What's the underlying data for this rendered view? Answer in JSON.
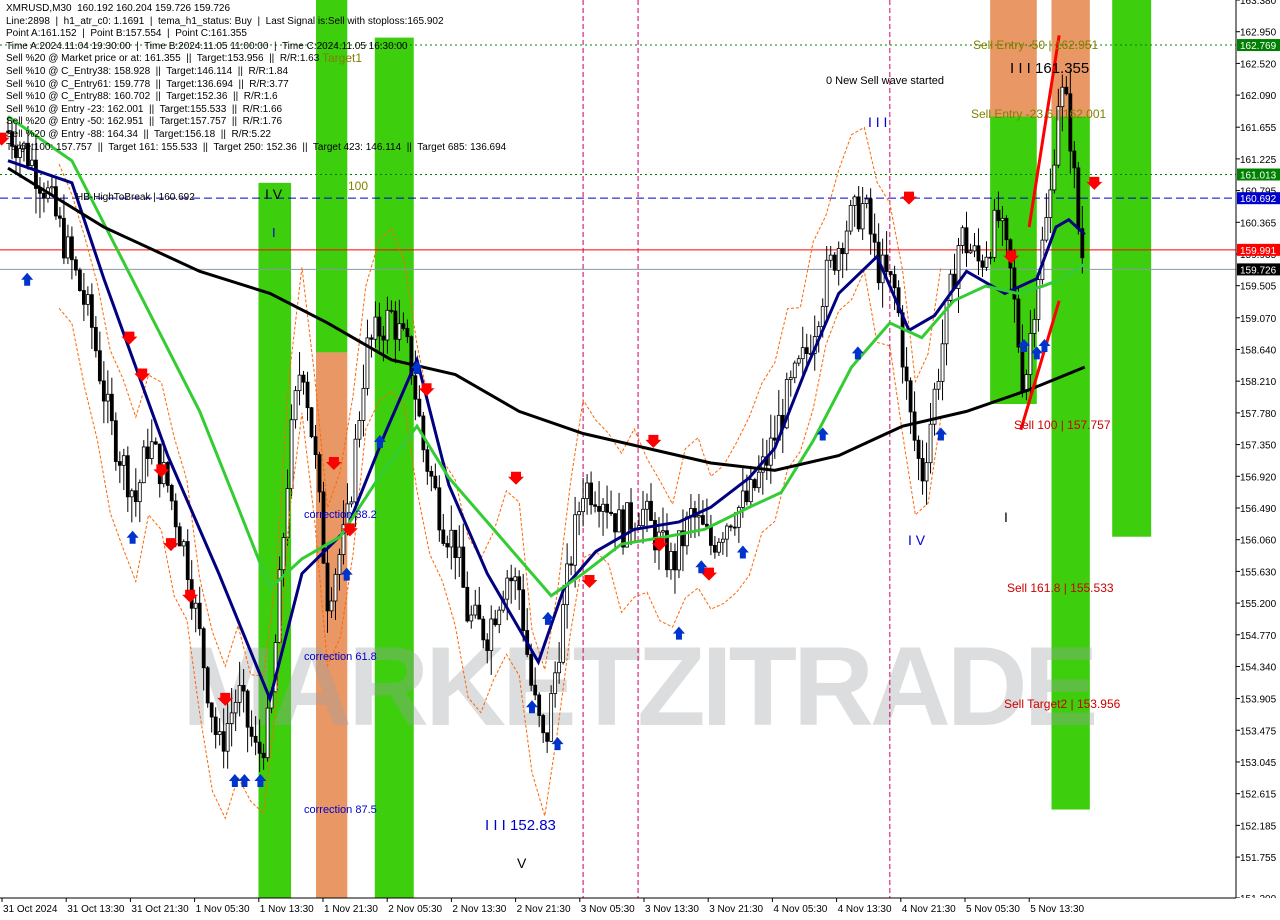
{
  "header": {
    "lines": [
      "XMRUSD,M30  160.192 160.204 159.726 159.726",
      "Line:2898  |  h1_atr_c0: 1.1691  |  tema_h1_status: Buy  |  Last Signal is:Sell with stoploss:165.902",
      "Point A:161.152  |  Point B:157.554  |  Point C:161.355",
      "Time A:2024.11.04 19:30:00  |  Time B:2024.11.05 11:00:00  |  Time C:2024.11.05 16:30:00",
      "Sell %20 @ Market price or at: 161.355  ||  Target:153.956  ||  R/R:1.63",
      "Sell %10 @ C_Entry38: 158.928  ||  Target:146.114  ||  R/R:1.84",
      "Sell %10 @ C_Entry61: 159.778  ||  Target:136.694  ||  R/R:3.77",
      "Sell %10 @ C_Entry88: 160.702  ||  Target:152.36  ||  R/R:1.6",
      "Sell %10 @ Entry -23: 162.001  ||  Target:155.533  ||  R/R:1.66",
      "Sell %20 @ Entry -50: 162.951  ||  Target:157.757  ||  R/R:1.76",
      "Sell %20 @ Entry -88: 164.34  ||  Target:156.18  ||  R/R:5.22",
      "Target100: 157.757  ||  Target 161: 155.533  ||  Target 250: 152.36  ||  Target 423: 146.114  ||  Target 685: 136.694"
    ]
  },
  "watermark": "MARKETZITRADE",
  "colors": {
    "up": "#ffffff",
    "down": "#000000",
    "green_zone": "#33cc00",
    "orange_zone": "#e8915c",
    "blue_ma": "#000080",
    "green_ma": "#33cc33",
    "black_ma": "#000000",
    "red_line": "#ff0000",
    "blue_dash": "#0000cc",
    "green_dot": "#008000",
    "magenta": "#cc0066"
  },
  "annotations": {
    "sell_entry_50": "Sell Entry -50 | 162.951",
    "sell_entry_23": "Sell Entry -23.6 | 162.001",
    "point_c": "I I I 161.355",
    "new_wave": "0 New Sell wave started",
    "wave_iii_top": "I I I",
    "wave_iv_left": "I V",
    "wave_i_left": "I",
    "label_100": "100",
    "target1": "Target1",
    "hb_break": "HB-HighToBreak | 160.692",
    "correction_38": "correction 38.2",
    "correction_61": "correction 61.8",
    "correction_87": "correction 87.5",
    "wave_iii_low": "I I I 152.83",
    "wave_v": "V",
    "wave_iv_right": "I V",
    "wave_i_right": "I",
    "sell_100": "Sell 100 | 157.757",
    "sell_161": "Sell 161.8 | 155.533",
    "sell_target2": "Sell Target2 | 153.956"
  },
  "price_tags": [
    {
      "value": 162.769,
      "label": "162.769",
      "bg": "#008000",
      "fg": "#ffffff"
    },
    {
      "value": 161.013,
      "label": "161.013",
      "bg": "#008000",
      "fg": "#ffffff"
    },
    {
      "value": 160.692,
      "label": "160.692",
      "bg": "#0000cc",
      "fg": "#ffffff"
    },
    {
      "value": 159.991,
      "label": "159.991",
      "bg": "#ff0000",
      "fg": "#ffffff"
    },
    {
      "value": 159.726,
      "label": "159.726",
      "bg": "#000000",
      "fg": "#ffffff"
    }
  ],
  "chart_data": {
    "type": "candlestick",
    "symbol": "XMRUSD",
    "timeframe": "M30",
    "ylim": [
      151.2,
      163.38
    ],
    "y_ticks": [
      "163.380",
      "162.950",
      "162.520",
      "162.090",
      "161.655",
      "161.225",
      "160.795",
      "160.365",
      "159.935",
      "159.505",
      "159.070",
      "158.640",
      "158.210",
      "157.780",
      "157.350",
      "156.920",
      "156.490",
      "156.060",
      "155.630",
      "155.200",
      "154.770",
      "154.340",
      "153.905",
      "153.475",
      "153.045",
      "152.615",
      "152.185",
      "151.755",
      "151.200"
    ],
    "x_labels": [
      "31 Oct 2024",
      "31 Oct 13:30",
      "31 Oct 21:30",
      "1 Nov 05:30",
      "1 Nov 13:30",
      "1 Nov 21:30",
      "2 Nov 05:30",
      "2 Nov 13:30",
      "2 Nov 21:30",
      "3 Nov 05:30",
      "3 Nov 13:30",
      "3 Nov 21:30",
      "4 Nov 05:30",
      "4 Nov 13:30",
      "4 Nov 21:30",
      "5 Nov 05:30",
      "5 Nov 13:30"
    ],
    "last_price": 159.726,
    "horizontal_levels": [
      {
        "name": "sell_entry_50",
        "value": 162.769,
        "style": "dotted",
        "color": "#008000"
      },
      {
        "name": "target_161",
        "value": 161.013,
        "style": "dotted",
        "color": "#008000"
      },
      {
        "name": "hb_high_to_break",
        "value": 160.692,
        "style": "dashed",
        "color": "#0000cc"
      },
      {
        "name": "stop_line",
        "value": 159.991,
        "style": "solid",
        "color": "#ff0000"
      },
      {
        "name": "last_price",
        "value": 159.726,
        "style": "solid",
        "color": "#8899aa"
      }
    ],
    "price_path": [
      [
        0,
        161.6
      ],
      [
        0.3,
        161.3
      ],
      [
        0.6,
        160.8
      ],
      [
        1,
        159.8
      ],
      [
        1.3,
        159.0
      ],
      [
        1.6,
        157.6
      ],
      [
        2,
        156.6
      ],
      [
        2.2,
        157.4
      ],
      [
        2.5,
        156.8
      ],
      [
        2.8,
        155.8
      ],
      [
        3.1,
        154.2
      ],
      [
        3.3,
        153.2
      ],
      [
        3.6,
        154.0
      ],
      [
        3.9,
        153.1
      ],
      [
        4.1,
        153.6
      ],
      [
        4.4,
        157.2
      ],
      [
        4.6,
        158.6
      ],
      [
        4.8,
        157.2
      ],
      [
        5.0,
        155.3
      ],
      [
        5.3,
        156.2
      ],
      [
        5.6,
        158.6
      ],
      [
        5.8,
        158.9
      ],
      [
        6.0,
        159.1
      ],
      [
        6.3,
        158.5
      ],
      [
        6.5,
        157.3
      ],
      [
        6.8,
        156.3
      ],
      [
        7.0,
        156.0
      ],
      [
        7.2,
        155.0
      ],
      [
        7.5,
        154.8
      ],
      [
        7.8,
        155.6
      ],
      [
        8.0,
        155.4
      ],
      [
        8.2,
        154.0
      ],
      [
        8.4,
        153.2
      ],
      [
        8.6,
        154.5
      ],
      [
        8.8,
        155.8
      ],
      [
        9.0,
        156.8
      ],
      [
        9.3,
        156.7
      ],
      [
        9.6,
        156.2
      ],
      [
        9.9,
        156.5
      ],
      [
        10.2,
        156.0
      ],
      [
        10.4,
        155.7
      ],
      [
        10.7,
        156.4
      ],
      [
        11.0,
        156.0
      ],
      [
        11.3,
        156.4
      ],
      [
        11.6,
        156.6
      ],
      [
        11.9,
        157.2
      ],
      [
        12.2,
        158.0
      ],
      [
        12.5,
        158.6
      ],
      [
        12.8,
        159.6
      ],
      [
        13.1,
        160.3
      ],
      [
        13.4,
        160.6
      ],
      [
        13.6,
        159.8
      ],
      [
        13.9,
        159.4
      ],
      [
        14.1,
        157.8
      ],
      [
        14.3,
        156.9
      ],
      [
        14.6,
        158.6
      ],
      [
        14.9,
        160.2
      ],
      [
        15.2,
        159.8
      ],
      [
        15.5,
        160.4
      ],
      [
        15.7,
        159.6
      ],
      [
        15.9,
        158.1
      ],
      [
        16.1,
        159.6
      ],
      [
        16.3,
        160.6
      ],
      [
        16.45,
        162.2
      ],
      [
        16.6,
        161.8
      ],
      [
        16.75,
        160.3
      ],
      [
        16.85,
        159.7
      ]
    ],
    "series": [
      {
        "name": "blue_ma",
        "color": "#000080",
        "points": [
          [
            0,
            161.2
          ],
          [
            1,
            160.9
          ],
          [
            1.5,
            159.6
          ],
          [
            2.5,
            157.2
          ],
          [
            3.3,
            155.6
          ],
          [
            4.1,
            153.9
          ],
          [
            4.6,
            155.6
          ],
          [
            5.3,
            156.2
          ],
          [
            5.9,
            157.5
          ],
          [
            6.4,
            158.5
          ],
          [
            6.9,
            156.8
          ],
          [
            7.5,
            155.6
          ],
          [
            8.3,
            154.4
          ],
          [
            8.7,
            155.4
          ],
          [
            9.2,
            155.9
          ],
          [
            9.8,
            156.2
          ],
          [
            10.5,
            156.3
          ],
          [
            11.0,
            156.5
          ],
          [
            11.6,
            156.9
          ],
          [
            12.0,
            157.3
          ],
          [
            12.5,
            158.4
          ],
          [
            13.0,
            159.4
          ],
          [
            13.6,
            159.9
          ],
          [
            14.1,
            158.9
          ],
          [
            14.5,
            159.1
          ],
          [
            15.0,
            159.7
          ],
          [
            15.6,
            159.4
          ],
          [
            16.1,
            159.6
          ],
          [
            16.4,
            160.3
          ],
          [
            16.6,
            160.4
          ],
          [
            16.85,
            160.2
          ]
        ]
      },
      {
        "name": "green_ma",
        "color": "#33cc33",
        "points": [
          [
            0,
            161.8
          ],
          [
            1,
            161.2
          ],
          [
            2,
            159.5
          ],
          [
            3,
            157.8
          ],
          [
            3.6,
            156.5
          ],
          [
            4.1,
            155.4
          ],
          [
            4.6,
            155.8
          ],
          [
            5.2,
            156.1
          ],
          [
            5.8,
            156.9
          ],
          [
            6.4,
            157.6
          ],
          [
            6.9,
            156.9
          ],
          [
            7.6,
            156.2
          ],
          [
            8.5,
            155.3
          ],
          [
            9.0,
            155.6
          ],
          [
            9.6,
            156.0
          ],
          [
            10.3,
            156.1
          ],
          [
            10.9,
            156.2
          ],
          [
            11.6,
            156.5
          ],
          [
            12.1,
            156.7
          ],
          [
            12.6,
            157.4
          ],
          [
            13.2,
            158.4
          ],
          [
            13.8,
            159.0
          ],
          [
            14.3,
            158.8
          ],
          [
            14.8,
            159.3
          ],
          [
            15.3,
            159.5
          ],
          [
            15.8,
            159.4
          ],
          [
            16.2,
            159.5
          ],
          [
            16.5,
            159.6
          ],
          [
            16.85,
            159.8
          ]
        ]
      },
      {
        "name": "black_ma",
        "color": "#000000",
        "points": [
          [
            0,
            161.1
          ],
          [
            1.5,
            160.3
          ],
          [
            3.0,
            159.7
          ],
          [
            4.1,
            159.4
          ],
          [
            5.0,
            159.0
          ],
          [
            6.0,
            158.5
          ],
          [
            7.0,
            158.3
          ],
          [
            8.0,
            157.8
          ],
          [
            9.0,
            157.5
          ],
          [
            10.0,
            157.3
          ],
          [
            11.0,
            157.1
          ],
          [
            12.0,
            157.0
          ],
          [
            13.0,
            157.2
          ],
          [
            14.0,
            157.6
          ],
          [
            15.0,
            157.8
          ],
          [
            16.0,
            158.1
          ],
          [
            16.85,
            158.4
          ]
        ]
      }
    ],
    "zones": [
      {
        "color": "#33cc00",
        "x0": 3.92,
        "x1": 4.43,
        "y0": 160.9,
        "y1": 151.2
      },
      {
        "color": "#33cc00",
        "x0": 4.82,
        "x1": 5.31,
        "y0": 163.38,
        "y1": 158.6
      },
      {
        "color": "#e8915c",
        "x0": 4.82,
        "x1": 5.31,
        "y0": 158.6,
        "y1": 151.2
      },
      {
        "color": "#33cc00",
        "x0": 5.74,
        "x1": 6.35,
        "y0": 162.87,
        "y1": 151.2
      },
      {
        "color": "#e8915c",
        "x0": 15.37,
        "x1": 16.1,
        "y0": 163.38,
        "y1": 161.8
      },
      {
        "color": "#33cc00",
        "x0": 15.37,
        "x1": 16.1,
        "y0": 161.8,
        "y1": 157.9
      },
      {
        "color": "#e8915c",
        "x0": 16.33,
        "x1": 16.93,
        "y0": 163.38,
        "y1": 161.8
      },
      {
        "color": "#33cc00",
        "x0": 16.33,
        "x1": 16.93,
        "y0": 161.8,
        "y1": 152.4
      },
      {
        "color": "#33cc00",
        "x0": 17.28,
        "x1": 17.89,
        "y0": 163.38,
        "y1": 156.1
      }
    ],
    "vertical_lines_x": [
      9.0,
      9.86,
      13.8
    ]
  }
}
